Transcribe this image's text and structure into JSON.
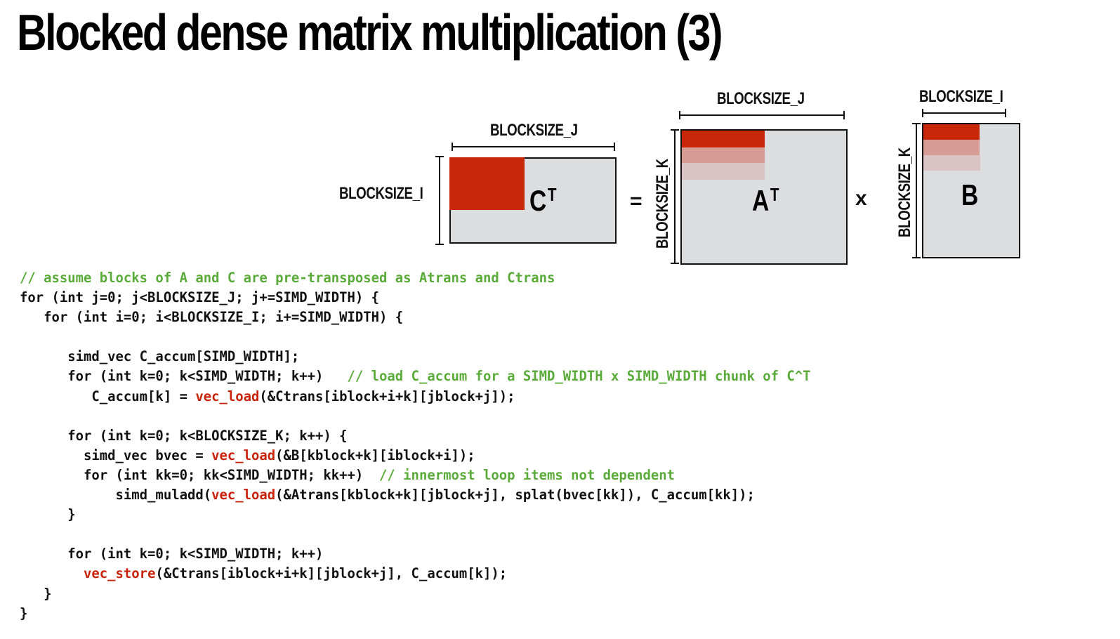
{
  "title": "Blocked dense matrix multiplication (3)",
  "diagram": {
    "colors": {
      "highlight": "#c8270a",
      "highlight_mid": "#d69b93",
      "highlight_light": "#d9c3c3",
      "matrix_fill": "#dcdddf",
      "outline": "#111111"
    },
    "ct": {
      "name": "C",
      "sup": "T",
      "top_label": "BLOCKSIZE_J",
      "side_label": "BLOCKSIZE_I"
    },
    "equals": "=",
    "at": {
      "name": "A",
      "sup": "T",
      "top_label": "BLOCKSIZE_J",
      "side_label": "BLOCKSIZE_K"
    },
    "times": "x",
    "b": {
      "name": "B",
      "top_label": "BLOCKSIZE_I",
      "side_label": "BLOCKSIZE_K"
    }
  },
  "code": {
    "lines": [
      [
        {
          "t": "// assume blocks of A and C are pre-transposed as Atrans and Ctrans",
          "k": "cm"
        }
      ],
      [
        {
          "t": "for (int j=0; j<BLOCKSIZE_J; j+=SIMD_WIDTH) {",
          "k": ""
        }
      ],
      [
        {
          "t": "   for (int i=0; i<BLOCKSIZE_I; i+=SIMD_WIDTH) {",
          "k": ""
        }
      ],
      [
        {
          "t": "",
          "k": ""
        }
      ],
      [
        {
          "t": "      simd_vec C_accum[SIMD_WIDTH];",
          "k": ""
        }
      ],
      [
        {
          "t": "      for (int k=0; k<SIMD_WIDTH; k++)   ",
          "k": ""
        },
        {
          "t": "// load C_accum for a SIMD_WIDTH x SIMD_WIDTH chunk of C^T",
          "k": "cm"
        }
      ],
      [
        {
          "t": "         C_accum[k] = ",
          "k": ""
        },
        {
          "t": "vec_load",
          "k": "fn"
        },
        {
          "t": "(&Ctrans[iblock+i+k][jblock+j]);",
          "k": ""
        }
      ],
      [
        {
          "t": "",
          "k": ""
        }
      ],
      [
        {
          "t": "      for (int k=0; k<BLOCKSIZE_K; k++) {",
          "k": ""
        }
      ],
      [
        {
          "t": "        simd_vec bvec = ",
          "k": ""
        },
        {
          "t": "vec_load",
          "k": "fn"
        },
        {
          "t": "(&B[kblock+k][iblock+i]);",
          "k": ""
        }
      ],
      [
        {
          "t": "        for (int kk=0; kk<SIMD_WIDTH; kk++)  ",
          "k": ""
        },
        {
          "t": "// innermost loop items not dependent",
          "k": "cm"
        }
      ],
      [
        {
          "t": "            simd_muladd(",
          "k": ""
        },
        {
          "t": "vec_load",
          "k": "fn"
        },
        {
          "t": "(&Atrans[kblock+k][jblock+j], splat(bvec[kk]), C_accum[kk]);",
          "k": ""
        }
      ],
      [
        {
          "t": "      }",
          "k": ""
        }
      ],
      [
        {
          "t": "",
          "k": ""
        }
      ],
      [
        {
          "t": "      for (int k=0; k<SIMD_WIDTH; k++)",
          "k": ""
        }
      ],
      [
        {
          "t": "        ",
          "k": ""
        },
        {
          "t": "vec_store",
          "k": "fn"
        },
        {
          "t": "(&Ctrans[iblock+i+k][jblock+j], C_accum[k]);",
          "k": ""
        }
      ],
      [
        {
          "t": "   }",
          "k": ""
        }
      ],
      [
        {
          "t": "}",
          "k": ""
        }
      ]
    ]
  }
}
